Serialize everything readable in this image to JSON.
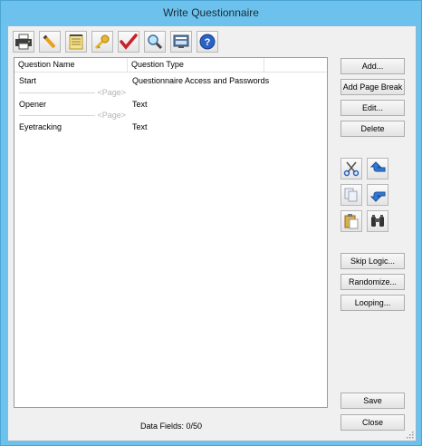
{
  "window": {
    "title": "Write Questionnaire"
  },
  "toolbar": [
    {
      "name": "print-icon"
    },
    {
      "name": "pencil-icon"
    },
    {
      "name": "notepad-icon"
    },
    {
      "name": "key-icon"
    },
    {
      "name": "checkmark-icon"
    },
    {
      "name": "magnifier-icon"
    },
    {
      "name": "test-screen-icon"
    },
    {
      "name": "help-icon"
    }
  ],
  "list": {
    "columns": [
      "Question Name",
      "Question Type"
    ],
    "rows": [
      {
        "name": "Start",
        "type": "Questionnaire Access and Passwords"
      },
      {
        "name": "Opener",
        "type": "Text"
      },
      {
        "name": "Eyetracking",
        "type": "Text"
      }
    ],
    "page_break_label": "<Page>"
  },
  "buttons": {
    "add": "Add...",
    "add_page_break": "Add Page Break",
    "edit": "Edit...",
    "delete": "Delete",
    "skip_logic": "Skip Logic...",
    "randomize": "Randomize...",
    "looping": "Looping...",
    "save": "Save",
    "close": "Close"
  },
  "edit_tools": [
    {
      "name": "cut-icon"
    },
    {
      "name": "move-up-icon"
    },
    {
      "name": "copy-icon"
    },
    {
      "name": "move-down-icon"
    },
    {
      "name": "paste-icon"
    },
    {
      "name": "find-binoculars-icon"
    }
  ],
  "status": {
    "data_fields": "Data Fields: 0/50"
  }
}
